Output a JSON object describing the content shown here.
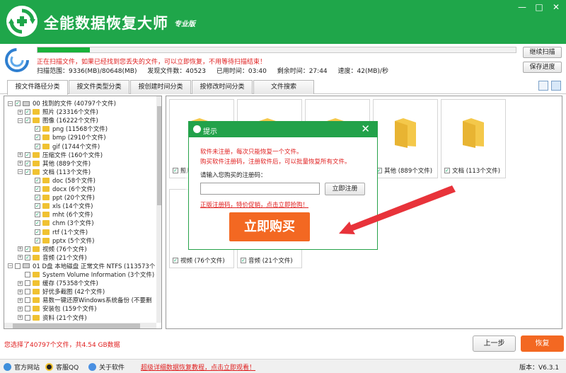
{
  "app": {
    "title": "全能数据恢复大师",
    "edition": "专业版",
    "colors": {
      "brand": "#1fa64a",
      "accent": "#f36822",
      "alert": "#e02020"
    }
  },
  "window_controls": {
    "minimize": "—",
    "maximize": "□",
    "close": "✕"
  },
  "scan": {
    "progress": 0.11,
    "message": "正在扫描文件，如果已经找到您丢失的文件，可以立即恢复，不用等待扫描结束！",
    "stats": {
      "range": "扫描范围：9336(MB)/80648(MB)",
      "found": "发现文件数：40523",
      "elapsed": "已用时间：03:40",
      "remaining": "剩余时间：27:44",
      "speed": "速度：42(MB)/秒"
    },
    "continue_label": "继续扫描",
    "save_label": "保存进度"
  },
  "tabs": [
    {
      "label": "按文件路径分类",
      "active": true
    },
    {
      "label": "按文件类型分类",
      "active": false
    },
    {
      "label": "按创建时间分类",
      "active": false
    },
    {
      "label": "按修改时间分类",
      "active": false
    },
    {
      "label": "文件搜索",
      "active": false
    }
  ],
  "tree": [
    {
      "indent": 0,
      "toggle": "−",
      "checked": true,
      "icon": "drive",
      "label": "00 找到的文件 (40797个文件)"
    },
    {
      "indent": 1,
      "toggle": "+",
      "checked": true,
      "icon": "folder",
      "label": "照片  (23316个文件)"
    },
    {
      "indent": 1,
      "toggle": "−",
      "checked": true,
      "icon": "folder",
      "label": "图像  (16222个文件)"
    },
    {
      "indent": 2,
      "toggle": "",
      "checked": true,
      "icon": "folder",
      "label": "png  (11568个文件)"
    },
    {
      "indent": 2,
      "toggle": "",
      "checked": true,
      "icon": "folder",
      "label": "bmp  (2910个文件)"
    },
    {
      "indent": 2,
      "toggle": "",
      "checked": true,
      "icon": "folder",
      "label": "gif  (1744个文件)"
    },
    {
      "indent": 1,
      "toggle": "+",
      "checked": true,
      "icon": "folder",
      "label": "压缩文件  (160个文件)"
    },
    {
      "indent": 1,
      "toggle": "+",
      "checked": true,
      "icon": "folder",
      "label": "其他  (889个文件)"
    },
    {
      "indent": 1,
      "toggle": "−",
      "checked": true,
      "icon": "folder",
      "label": "文档  (113个文件)"
    },
    {
      "indent": 2,
      "toggle": "",
      "checked": true,
      "icon": "folder",
      "label": "doc  (58个文件)"
    },
    {
      "indent": 2,
      "toggle": "",
      "checked": true,
      "icon": "folder",
      "label": "docx  (6个文件)"
    },
    {
      "indent": 2,
      "toggle": "",
      "checked": true,
      "icon": "folder",
      "label": "ppt  (20个文件)"
    },
    {
      "indent": 2,
      "toggle": "",
      "checked": true,
      "icon": "folder",
      "label": "xls  (14个文件)"
    },
    {
      "indent": 2,
      "toggle": "",
      "checked": true,
      "icon": "folder",
      "label": "mht  (6个文件)"
    },
    {
      "indent": 2,
      "toggle": "",
      "checked": true,
      "icon": "folder",
      "label": "chm  (3个文件)"
    },
    {
      "indent": 2,
      "toggle": "",
      "checked": true,
      "icon": "folder",
      "label": "rtf  (1个文件)"
    },
    {
      "indent": 2,
      "toggle": "",
      "checked": true,
      "icon": "folder",
      "label": "pptx  (5个文件)"
    },
    {
      "indent": 1,
      "toggle": "+",
      "checked": true,
      "icon": "folder",
      "label": "视频  (76个文件)"
    },
    {
      "indent": 1,
      "toggle": "+",
      "checked": true,
      "icon": "folder",
      "label": "音频  (21个文件)"
    },
    {
      "indent": 0,
      "toggle": "−",
      "checked": false,
      "icon": "drive",
      "label": "01 D盘 本地磁盘 正常文件 NTFS  (113573个"
    },
    {
      "indent": 1,
      "toggle": "",
      "checked": false,
      "icon": "folder",
      "label": "System Volume Information  (3个文件)"
    },
    {
      "indent": 1,
      "toggle": "+",
      "checked": false,
      "icon": "folder",
      "label": "缓存  (75358个文件)"
    },
    {
      "indent": 1,
      "toggle": "+",
      "checked": false,
      "icon": "folder",
      "label": "好优多截图  (42个文件)"
    },
    {
      "indent": 1,
      "toggle": "+",
      "checked": false,
      "icon": "folder",
      "label": "易数一键还原Windows系统备份 (不要删"
    },
    {
      "indent": 1,
      "toggle": "+",
      "checked": false,
      "icon": "folder",
      "label": "安装包  (159个文件)"
    },
    {
      "indent": 1,
      "toggle": "+",
      "checked": false,
      "icon": "folder",
      "label": "资料  (21个文件)"
    }
  ],
  "files": [
    {
      "label": "照片"
    },
    {
      "label": ""
    },
    {
      "label": ""
    },
    {
      "label": "其他  (889个文件)"
    },
    {
      "label": "文档  (113个文件)"
    },
    {
      "label": "视频  (76个文件)"
    },
    {
      "label": "音频  (21个文件)"
    }
  ],
  "dialog": {
    "title": "提示",
    "close": "✕",
    "msg1": "软件未注册，每次只能恢复一个文件。",
    "msg2": "购买软件注册码，注册软件后，可以批量恢复所有文件。",
    "prompt": "请输入您购买的注册码：",
    "input_value": "",
    "register_label": "立即注册",
    "promo_link": "正版注册码，特价促销，点击立即抢购！",
    "buy_label": "立即购买"
  },
  "status": {
    "selection": "您选择了40797个文件，共4.54 GB数据",
    "prev_label": "上一步",
    "recover_label": "恢复"
  },
  "bottom": {
    "site": "官方网站",
    "qq": "客服QQ",
    "about": "关于软件",
    "tutorial": "超级详细数据恢复教程，点击立即观看！",
    "version_label": "版本：",
    "version": "V6.3.1"
  }
}
